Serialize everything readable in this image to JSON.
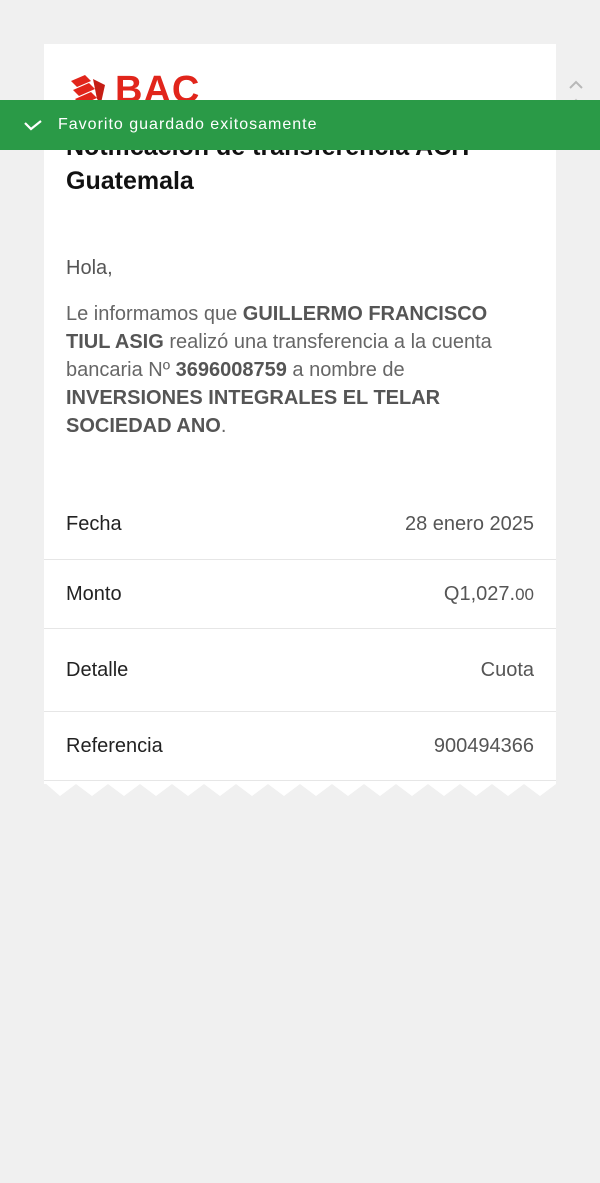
{
  "brand": {
    "logo_text": "BAC",
    "brand_color": "#e1251b"
  },
  "toast": {
    "message": "Favorito guardado exitosamente",
    "color": "#2a9a47",
    "icon": "check-icon"
  },
  "email": {
    "title": "Notificación de transferencia ACH Guatemala",
    "greeting": "Hola,",
    "msg_part1": "Le informamos que ",
    "sender": "GUILLERMO FRANCISCO TIUL ASIG",
    "msg_part2": " realizó una transferencia a la cuenta bancaria Nº ",
    "account_number": "3696008759",
    "msg_part3": " a nombre de ",
    "recipient": "INVERSIONES INTEGRALES EL TELAR SOCIEDAD ANO",
    "msg_part4": "."
  },
  "details": {
    "fecha_label": "Fecha",
    "fecha_value": "28 enero 2025",
    "monto_label": "Monto",
    "monto_value": "Q1,027.",
    "monto_cents": "00",
    "detalle_label": "Detalle",
    "detalle_value": "Cuota",
    "referencia_label": "Referencia",
    "referencia_value": "900494366"
  }
}
